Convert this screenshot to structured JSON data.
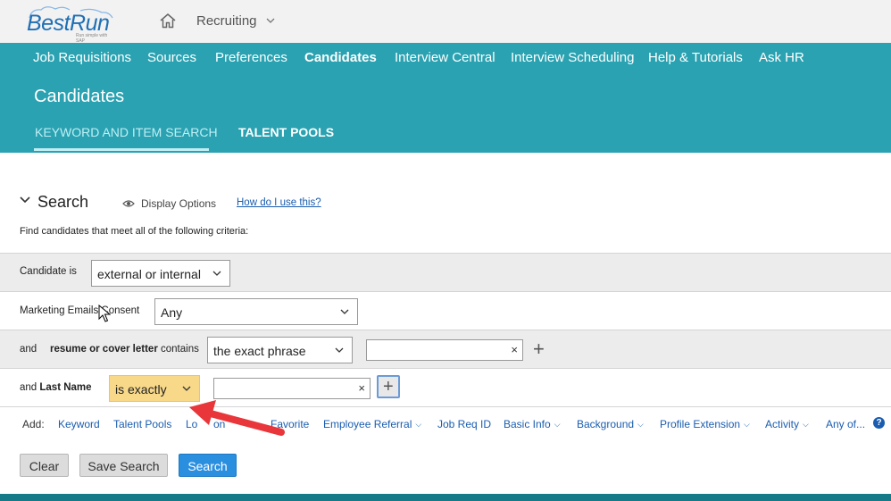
{
  "brand": {
    "name": "BestRun",
    "tagline": "Run simple with SAP"
  },
  "header": {
    "module_label": "Recruiting"
  },
  "nav": {
    "items": [
      {
        "label": "Job Requisitions"
      },
      {
        "label": "Sources"
      },
      {
        "label": "Preferences"
      },
      {
        "label": "Candidates"
      },
      {
        "label": "Interview Central"
      },
      {
        "label": "Interview Scheduling"
      },
      {
        "label": "Help & Tutorials"
      },
      {
        "label": "Ask HR"
      }
    ],
    "active": "Candidates"
  },
  "page": {
    "title": "Candidates"
  },
  "subtabs": [
    {
      "label": "KEYWORD AND ITEM SEARCH"
    },
    {
      "label": "TALENT POOLS"
    }
  ],
  "search": {
    "title": "Search",
    "display_options": "Display Options",
    "how_link": "How do I use this?",
    "instructions": "Find candidates that meet all of the following criteria:",
    "rows": [
      {
        "label": "Candidate is",
        "select": "external or internal"
      },
      {
        "label": "Marketing Emails Consent",
        "select": "Any"
      },
      {
        "prefix": "and",
        "field": "resume or cover letter",
        "suffix": "contains",
        "select": "the exact phrase",
        "input_value": ""
      },
      {
        "prefix": "and",
        "field": "Last Name",
        "select": "is exactly",
        "input_value": ""
      }
    ],
    "clear_glyph": "×",
    "plus_glyph": "+"
  },
  "add_bar": {
    "label": "Add:",
    "links": [
      {
        "label": "Keyword",
        "has_dropdown": false
      },
      {
        "label": "Talent Pools",
        "has_dropdown": false
      },
      {
        "label": "Lo",
        "has_dropdown": false
      },
      {
        "label": "on",
        "has_dropdown": false
      },
      {
        "label": "Favorite",
        "has_dropdown": false
      },
      {
        "label": "Employee Referral",
        "has_dropdown": true
      },
      {
        "label": "Job Req ID",
        "has_dropdown": false
      },
      {
        "label": "Basic Info",
        "has_dropdown": true
      },
      {
        "label": "Background",
        "has_dropdown": true
      },
      {
        "label": "Profile Extension",
        "has_dropdown": true
      },
      {
        "label": "Activity",
        "has_dropdown": true
      },
      {
        "label": "Any of...",
        "has_dropdown": true
      }
    ],
    "help_glyph": "?"
  },
  "buttons": {
    "clear": "Clear",
    "save": "Save Search",
    "search": "Search"
  },
  "colors": {
    "teal": "#2aa2b1",
    "teal_dark": "#177a89",
    "link_blue": "#1a5db0",
    "primary_button": "#2b8fe0",
    "highlight": "#f8d98a",
    "annotation_arrow": "#e8363a"
  },
  "icons": [
    "home-icon",
    "chevron-down-icon",
    "eye-icon",
    "clear-icon",
    "plus-icon",
    "help-icon",
    "mouse-cursor-icon",
    "annotation-arrow-icon"
  ]
}
